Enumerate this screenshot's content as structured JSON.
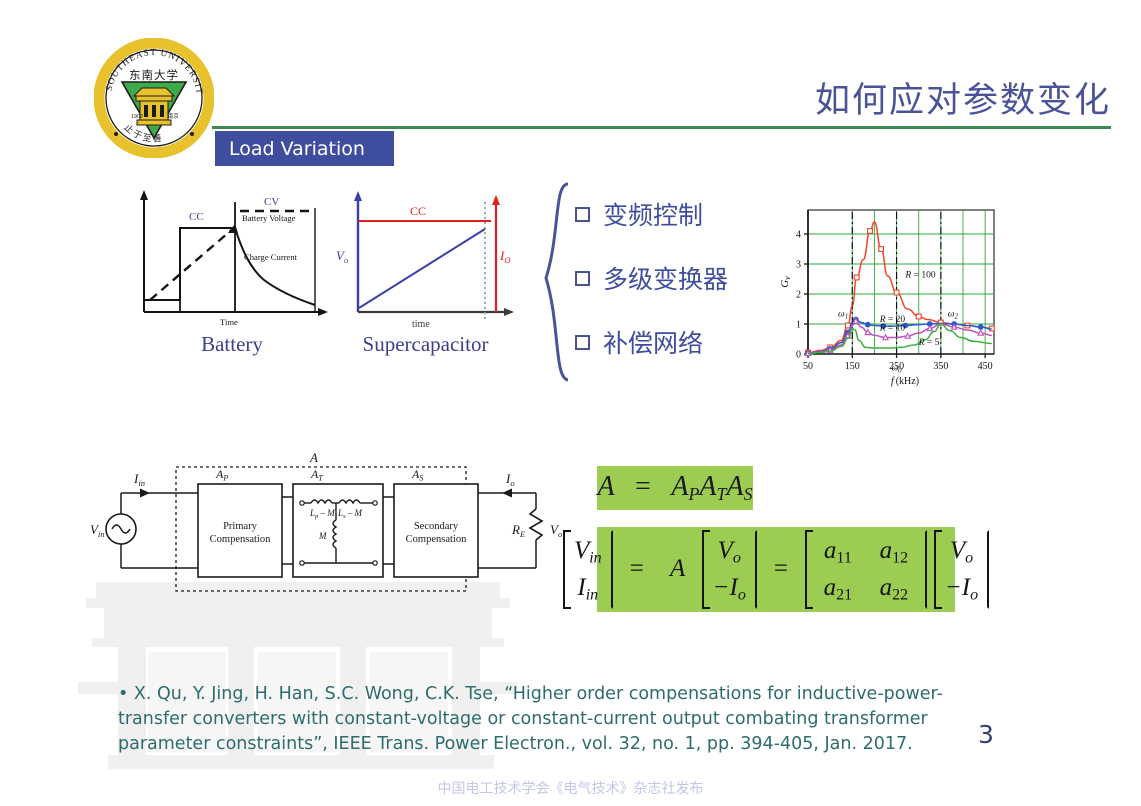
{
  "slide": {
    "title": "如何应对参数变化",
    "page_number": "3",
    "section_tag": "Load Variation",
    "accent_rule_color": "#3c8a4e",
    "tag_bg_color": "#3f4d9e",
    "title_color": "#4a5398",
    "equation_bg_color": "#9dcc52",
    "citation_color": "#2e6c6d"
  },
  "logo": {
    "name": "southeast-university-logo",
    "outer_text_top": "SOUTHEAST UNIVERSITY",
    "inner_text": "东南大学",
    "year": "1902",
    "city": "南京",
    "motto": "止于至善",
    "ring_color": "#e8c22c",
    "triangle_color": "#3faa4a"
  },
  "bullets": [
    {
      "label": "变频控制",
      "icon": "square-bullet-icon"
    },
    {
      "label": "多级变换器",
      "icon": "square-bullet-icon"
    },
    {
      "label": "补偿网络",
      "icon": "square-bullet-icon"
    }
  ],
  "battery_chart": {
    "caption": "Battery",
    "labels": {
      "cc": "CC",
      "cv": "CV",
      "voltage_curve": "Battery Voltage",
      "current_curve": "Charge Current",
      "xaxis": "Time"
    },
    "cc_color": "#3c3f8f",
    "cv_color": "#3c3f8f"
  },
  "supercap_chart": {
    "caption": "Supercapacitor",
    "labels": {
      "cc": "CC",
      "vo": "V",
      "vo_sub": "o",
      "io": "I",
      "io_sub": "O",
      "xaxis": "time"
    },
    "vo_color": "#3a3fa8",
    "io_color": "#e02020",
    "cc_color": "#e02020"
  },
  "chart_data": {
    "type": "line",
    "title": "",
    "xlabel": "f (kHz)",
    "ylabel": "Gv",
    "xlim": [
      50,
      470
    ],
    "ylim": [
      0,
      4.8
    ],
    "xticks": [
      50,
      150,
      250,
      350,
      450
    ],
    "yticks": [
      0,
      1,
      2,
      3,
      4
    ],
    "grid": true,
    "grid_color": "#2fa83c",
    "legend_position": "inline-annotations",
    "annotations": [
      {
        "text": "ω1",
        "x": 152,
        "y": 1.25
      },
      {
        "text": "ω0",
        "x": 250,
        "y": -0.55
      },
      {
        "text": "ω2",
        "x": 350,
        "y": 1.25
      }
    ],
    "vlines": [
      150,
      250,
      350
    ],
    "series": [
      {
        "name": "R = 100",
        "color": "#f0452a",
        "marker": "square-open",
        "label_pos": {
          "x": 270,
          "y": 2.55
        },
        "x": [
          50,
          80,
          100,
          125,
          140,
          150,
          160,
          175,
          190,
          200,
          215,
          230,
          250,
          275,
          300,
          320,
          350,
          380,
          410,
          440,
          465
        ],
        "y": [
          0.05,
          0.12,
          0.22,
          0.45,
          0.95,
          1.6,
          2.55,
          3.15,
          4.1,
          4.4,
          3.5,
          2.6,
          2.05,
          1.5,
          1.25,
          1.15,
          1.05,
          1.0,
          0.95,
          0.9,
          0.85
        ]
      },
      {
        "name": "R = 20",
        "color": "#2b5bd0",
        "marker": "circle-filled",
        "label_pos": {
          "x": 212,
          "y": 1.06
        },
        "x": [
          50,
          80,
          100,
          125,
          140,
          150,
          158,
          170,
          185,
          200,
          220,
          245,
          270,
          300,
          325,
          350,
          380,
          410,
          440,
          465
        ],
        "y": [
          0.03,
          0.09,
          0.17,
          0.38,
          0.72,
          1.05,
          1.15,
          1.05,
          0.98,
          0.95,
          0.93,
          0.93,
          0.95,
          0.98,
          1.0,
          1.02,
          1.0,
          0.95,
          0.9,
          0.83
        ]
      },
      {
        "name": "R = 10",
        "color": "#c052c0",
        "marker": "triangle-open",
        "label_pos": {
          "x": 212,
          "y": 0.78
        },
        "x": [
          50,
          80,
          100,
          125,
          140,
          150,
          158,
          170,
          185,
          200,
          225,
          250,
          275,
          300,
          325,
          350,
          380,
          410,
          440,
          465
        ],
        "y": [
          0.02,
          0.07,
          0.13,
          0.3,
          0.6,
          0.95,
          1.1,
          0.9,
          0.72,
          0.62,
          0.55,
          0.55,
          0.6,
          0.7,
          0.85,
          1.0,
          0.9,
          0.8,
          0.7,
          0.62
        ]
      },
      {
        "name": "R = 5",
        "color": "#3fae40",
        "marker": "none",
        "label_pos": {
          "x": 300,
          "y": 0.3
        },
        "x": [
          50,
          80,
          100,
          125,
          142,
          150,
          156,
          165,
          180,
          200,
          230,
          260,
          290,
          315,
          335,
          350,
          370,
          395,
          425,
          465
        ],
        "y": [
          0.01,
          0.05,
          0.1,
          0.25,
          0.55,
          0.85,
          0.8,
          0.45,
          0.22,
          0.2,
          0.2,
          0.22,
          0.3,
          0.48,
          0.75,
          1.0,
          0.78,
          0.55,
          0.42,
          0.35
        ]
      }
    ]
  },
  "circuit": {
    "outer_label": "A",
    "source": {
      "v": "V",
      "v_sub": "in"
    },
    "current_in": {
      "i": "I",
      "i_sub": "in"
    },
    "blocks": [
      {
        "tag": "A",
        "tag_sub": "P",
        "line1": "Primary",
        "line2": "Compensation"
      },
      {
        "tag": "A",
        "tag_sub": "T",
        "line1": "",
        "line2": ""
      },
      {
        "tag": "A",
        "tag_sub": "S",
        "line1": "Secondary",
        "line2": "Compensation"
      }
    ],
    "transformer": {
      "primary": "L",
      "primary_sub": "p",
      "primary_tail": " – M",
      "secondary": "L",
      "secondary_sub": "s",
      "secondary_tail": " – M",
      "mutual": "M"
    },
    "load": {
      "r": "R",
      "r_sub": "E",
      "v": "V",
      "v_sub": "o"
    },
    "current_out": {
      "i": "I",
      "i_sub": "o"
    }
  },
  "equations": {
    "eq1": {
      "a": "A",
      "eq": "=",
      "ap": "A",
      "ap_sub": "P",
      "at": "A",
      "at_sub": "T",
      "as": "A",
      "as_sub": "S"
    },
    "eq2": {
      "lhs": [
        {
          "v": "V",
          "sub": "in"
        },
        {
          "v": "I",
          "sub": "in"
        }
      ],
      "eq1": "=",
      "A": "A",
      "mid": [
        {
          "v": "V",
          "sub": "o"
        },
        {
          "v": "−I",
          "sub": "o"
        }
      ],
      "eq2": "=",
      "matrix": [
        [
          "a11",
          "a12"
        ],
        [
          "a21",
          "a22"
        ]
      ],
      "rhs": [
        {
          "v": "V",
          "sub": "o"
        },
        {
          "v": "−I",
          "sub": "o"
        }
      ]
    }
  },
  "citation": "• X. Qu, Y. Jing, H. Han, S.C. Wong, C.K. Tse, “Higher order compensations for inductive-power-transfer converters with constant-voltage or constant-current output combating transformer parameter constraints”, IEEE Trans. Power Electron., vol. 32, no. 1, pp. 394-405, Jan. 2017.",
  "footer": "中国电工技术学会《电气技术》杂志社发布"
}
